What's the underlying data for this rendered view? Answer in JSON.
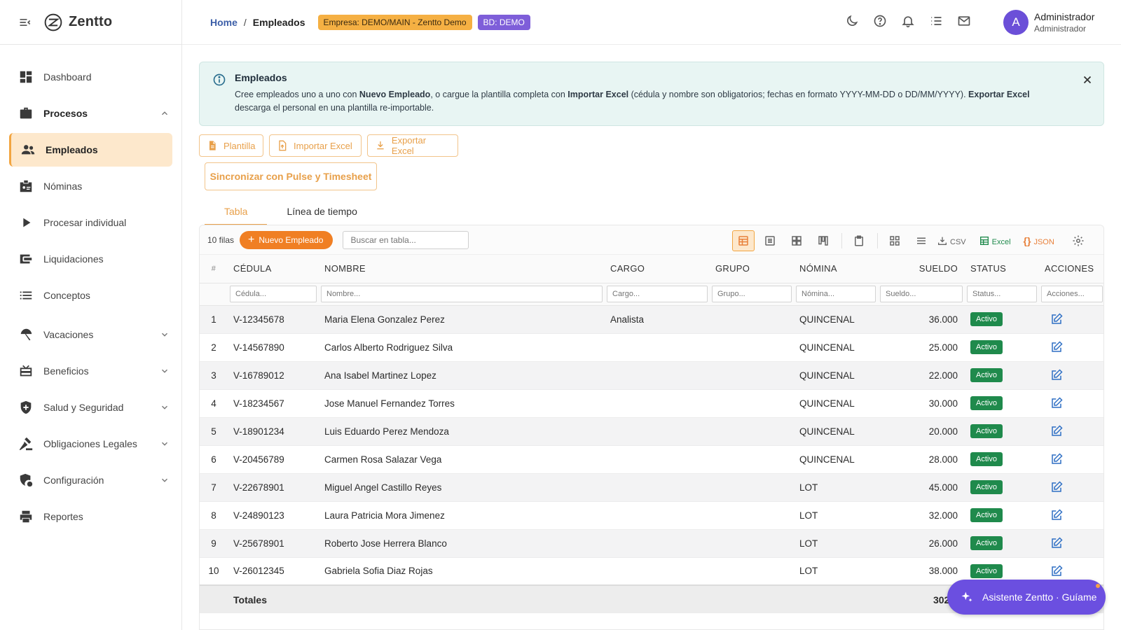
{
  "app": {
    "name": "Zentto"
  },
  "sidebar": {
    "items": [
      {
        "label": "Dashboard"
      },
      {
        "label": "Procesos"
      },
      {
        "label": "Empleados"
      },
      {
        "label": "Nóminas"
      },
      {
        "label": "Procesar individual"
      },
      {
        "label": "Liquidaciones"
      },
      {
        "label": "Conceptos"
      },
      {
        "label": "Vacaciones"
      },
      {
        "label": "Beneficios"
      },
      {
        "label": "Salud y Seguridad"
      },
      {
        "label": "Obligaciones Legales"
      },
      {
        "label": "Configuración"
      },
      {
        "label": "Reportes"
      }
    ]
  },
  "header": {
    "breadcrumb": {
      "home": "Home",
      "separator": "/",
      "current": "Empleados"
    },
    "badges": {
      "empresa": "Empresa: DEMO/MAIN - Zentto Demo",
      "bd": "BD: DEMO"
    },
    "user": {
      "initial": "A",
      "name": "Administrador",
      "role": "Administrador"
    }
  },
  "alert": {
    "title": "Empleados",
    "text_1": "Cree empleados uno a uno con ",
    "bold_1": "Nuevo Empleado",
    "text_2": ", o cargue la plantilla completa con ",
    "bold_2": "Importar Excel",
    "text_3": " (cédula y nombre son obligatorios; fechas en formato YYYY-MM-DD o DD/MM/YYYY). ",
    "bold_3": "Exportar Excel",
    "text_4": " descarga el personal en una plantilla re-importable."
  },
  "toolbar": {
    "plantilla": "Plantilla",
    "importar": "Importar Excel",
    "exportar": "Exportar Excel",
    "sync": "Sincronizar con Pulse y Timesheet"
  },
  "tabs": [
    {
      "label": "Tabla"
    },
    {
      "label": "Línea de tiempo"
    }
  ],
  "grid": {
    "row_count": "10 filas",
    "new_button": "Nuevo Empleado",
    "search_placeholder": "Buscar en tabla...",
    "export_csv": "CSV",
    "export_excel": "Excel",
    "export_json": "JSON",
    "columns": {
      "num": "#",
      "cedula": "CÉDULA",
      "nombre": "NOMBRE",
      "cargo": "CARGO",
      "grupo": "GRUPO",
      "nomina": "NÓMINA",
      "sueldo": "SUELDO",
      "status": "STATUS",
      "acciones": "ACCIONES"
    },
    "filters": {
      "cedula": "Cédula...",
      "nombre": "Nombre...",
      "cargo": "Cargo...",
      "grupo": "Grupo...",
      "nomina": "Nómina...",
      "sueldo": "Sueldo...",
      "status": "Status...",
      "acciones": "Acciones..."
    },
    "rows": [
      {
        "n": "1",
        "cedula": "V-12345678",
        "nombre": "Maria Elena Gonzalez Perez",
        "cargo": "Analista",
        "grupo": "",
        "nomina": "QUINCENAL",
        "sueldo": "36.000",
        "status": "Activo"
      },
      {
        "n": "2",
        "cedula": "V-14567890",
        "nombre": "Carlos Alberto Rodriguez Silva",
        "cargo": "",
        "grupo": "",
        "nomina": "QUINCENAL",
        "sueldo": "25.000",
        "status": "Activo"
      },
      {
        "n": "3",
        "cedula": "V-16789012",
        "nombre": "Ana Isabel Martinez Lopez",
        "cargo": "",
        "grupo": "",
        "nomina": "QUINCENAL",
        "sueldo": "22.000",
        "status": "Activo"
      },
      {
        "n": "4",
        "cedula": "V-18234567",
        "nombre": "Jose Manuel Fernandez Torres",
        "cargo": "",
        "grupo": "",
        "nomina": "QUINCENAL",
        "sueldo": "30.000",
        "status": "Activo"
      },
      {
        "n": "5",
        "cedula": "V-18901234",
        "nombre": "Luis Eduardo Perez Mendoza",
        "cargo": "",
        "grupo": "",
        "nomina": "QUINCENAL",
        "sueldo": "20.000",
        "status": "Activo"
      },
      {
        "n": "6",
        "cedula": "V-20456789",
        "nombre": "Carmen Rosa Salazar Vega",
        "cargo": "",
        "grupo": "",
        "nomina": "QUINCENAL",
        "sueldo": "28.000",
        "status": "Activo"
      },
      {
        "n": "7",
        "cedula": "V-22678901",
        "nombre": "Miguel Angel Castillo Reyes",
        "cargo": "",
        "grupo": "",
        "nomina": "LOT",
        "sueldo": "45.000",
        "status": "Activo"
      },
      {
        "n": "8",
        "cedula": "V-24890123",
        "nombre": "Laura Patricia Mora Jimenez",
        "cargo": "",
        "grupo": "",
        "nomina": "LOT",
        "sueldo": "32.000",
        "status": "Activo"
      },
      {
        "n": "9",
        "cedula": "V-25678901",
        "nombre": "Roberto Jose Herrera Blanco",
        "cargo": "",
        "grupo": "",
        "nomina": "LOT",
        "sueldo": "26.000",
        "status": "Activo"
      },
      {
        "n": "10",
        "cedula": "V-26012345",
        "nombre": "Gabriela Sofia Diaz Rojas",
        "cargo": "",
        "grupo": "",
        "nomina": "LOT",
        "sueldo": "38.000",
        "status": "Activo"
      }
    ],
    "totals": {
      "label": "Totales",
      "sueldo": "302.0"
    }
  },
  "assistant": {
    "label": "Asistente Zentto · Guíame"
  },
  "colors": {
    "accent": "#f07f23",
    "purple": "#6b4fe0",
    "status_green": "#1f8a4c",
    "active_bg": "#fde8cc"
  }
}
